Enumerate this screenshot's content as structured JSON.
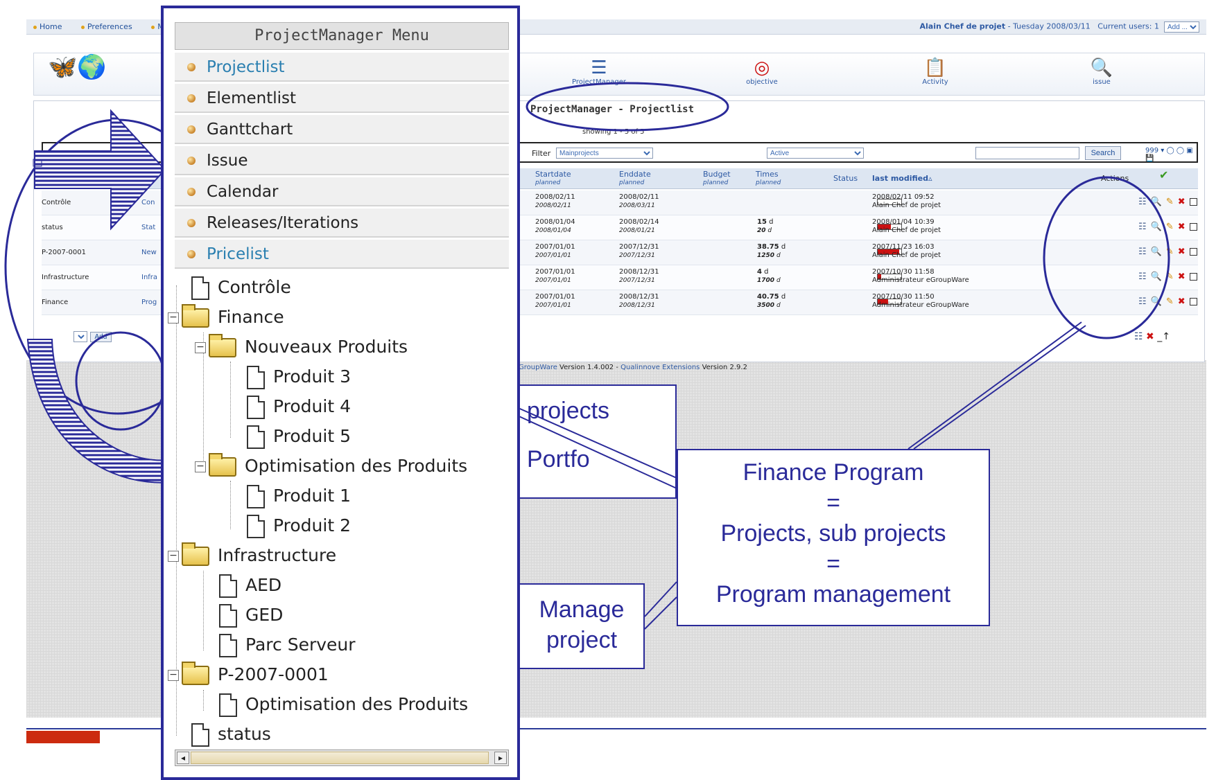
{
  "topbar": {
    "nav": [
      "Home",
      "Preferences",
      "Ma"
    ],
    "user_name": "Alain Chef de projet",
    "date_text": " - Tuesday 2008/03/11",
    "current_users": "Current users: 1",
    "add_select": "Add ..."
  },
  "apps": [
    {
      "label": "ProjectManager",
      "icon": "projectmanager-icon"
    },
    {
      "label": "objective",
      "icon": "target-icon"
    },
    {
      "label": "Activity",
      "icon": "activity-icon"
    },
    {
      "label": "issue",
      "icon": "issue-icon"
    }
  ],
  "page": {
    "title": "ProjectManager - Projectlist",
    "showing": "showing 1 - 5 of 5",
    "filter_label": "Filter",
    "filter_value": "Mainprojects",
    "status_filter": "Active",
    "search_button": "Search",
    "per_page": "999"
  },
  "table": {
    "headers": {
      "start": "Startdate",
      "start_sub": "planned",
      "end": "Enddate",
      "end_sub": "planned",
      "budget": "Budget",
      "budget_sub": "planned",
      "times": "Times",
      "times_sub": "planned",
      "status": "Status",
      "modified": "last modified",
      "actions": "Actions"
    },
    "rows": [
      {
        "left": "Contrôle",
        "col2": "Con",
        "start": "2008/02/11",
        "start_p": "2008/02/11",
        "end": "2008/02/11",
        "end_p": "2008/03/11",
        "times": "",
        "times_p": "",
        "progress": 0,
        "mod_date": "2008/02/11 09:52",
        "mod_by": "Alain Chef de projet"
      },
      {
        "left": "status",
        "col2": "Stat",
        "start": "2008/01/04",
        "start_p": "2008/01/04",
        "end": "2008/02/14",
        "end_p": "2008/01/21",
        "times": "15",
        "times_p": "20",
        "progress": 0.55,
        "mod_date": "2008/01/04 10:39",
        "mod_by": "Alain Chef de projet"
      },
      {
        "left": "P-2007-0001",
        "col2": "New",
        "start": "2007/01/01",
        "start_p": "2007/01/01",
        "end": "2007/12/31",
        "end_p": "2007/12/31",
        "times": "38.75",
        "times_p": "1250",
        "progress": 0.9,
        "mod_date": "2007/11/23 16:03",
        "mod_by": "Alain Chef de projet"
      },
      {
        "left": "Infrastructure",
        "col2": "Infra",
        "start": "2007/01/01",
        "start_p": "2007/01/01",
        "end": "2008/12/31",
        "end_p": "2007/12/31",
        "times": "4",
        "times_p": "1700",
        "progress": 0.15,
        "mod_date": "2007/10/30 11:58",
        "mod_by": "Administrateur eGroupWare"
      },
      {
        "left": "Finance",
        "col2": "Prog",
        "start": "2007/01/01",
        "start_p": "2007/01/01",
        "end": "2008/12/31",
        "end_p": "2008/12/31",
        "times": "40.75",
        "times_p": "3500",
        "progress": 0.45,
        "mod_date": "2007/10/30 11:50",
        "mod_by": "Administrateur eGroupWare"
      }
    ],
    "unit": "d",
    "add_button": "Add"
  },
  "footer": {
    "version_prefix": "GroupWare",
    "version_text": " Version 1.4.002 - ",
    "ext_link": "Qualinnove Extensions",
    "ext_version": " Version 2.9.2"
  },
  "menu": {
    "title": "ProjectManager Menu",
    "items": [
      "Projectlist",
      "Elementlist",
      "Ganttchart",
      "Issue",
      "Calendar",
      "Releases/Iterations",
      "Pricelist"
    ],
    "tree": [
      "Contrôle",
      "Finance",
      "Nouveaux Produits",
      "Produit 3",
      "Produit 4",
      "Produit 5",
      "Optimisation des Produits",
      "Produit 1",
      "Produit 2",
      "Infrastructure",
      "AED",
      "GED",
      "Parc Serveur",
      "P-2007-0001",
      "Optimisation des Produits",
      "status"
    ]
  },
  "callouts": {
    "projects_a": "projects",
    "projects_b": "Portfo",
    "finance_l1": "Finance Program",
    "finance_l2": "=",
    "finance_l3": "Projects, sub projects",
    "finance_l4": "=",
    "finance_l5": "Program management",
    "manage_l1": "Manage",
    "manage_l2": "project"
  },
  "colors": {
    "accent_navy": "#2a2a99",
    "link_blue": "#2d59a3",
    "status_red": "#cc1111",
    "footer_red": "#cc2b0f"
  }
}
